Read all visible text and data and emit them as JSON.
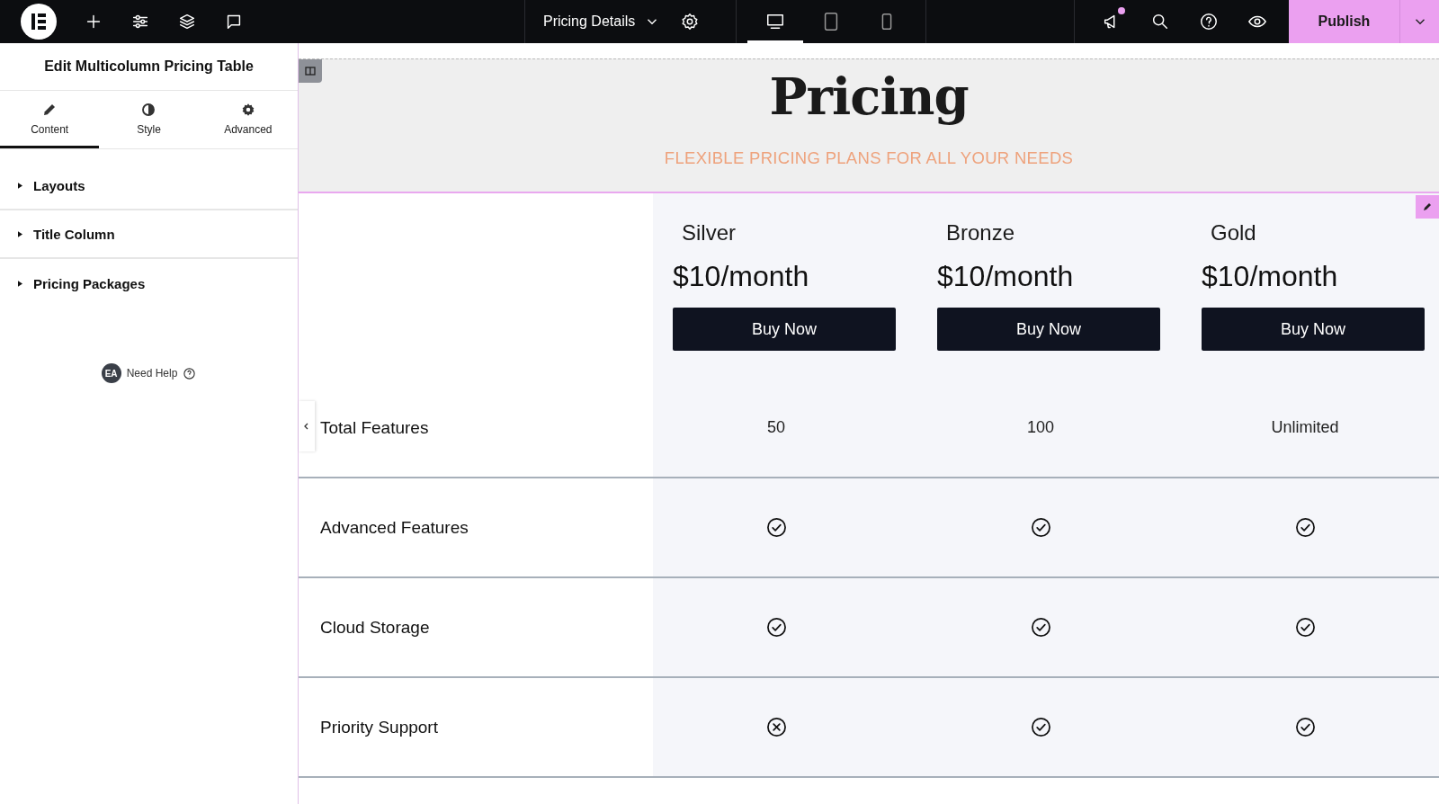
{
  "topbar": {
    "page_title": "Pricing Details",
    "devices": [
      {
        "kind": "desktop",
        "selected": true
      },
      {
        "kind": "tablet",
        "selected": false
      },
      {
        "kind": "mobile",
        "selected": false
      }
    ],
    "notification": true,
    "publish_label": "Publish"
  },
  "panel": {
    "title": "Edit Multicolumn Pricing Table",
    "tabs": [
      {
        "label": "Content",
        "kind": "pencil",
        "selected": true
      },
      {
        "label": "Style",
        "kind": "contrast",
        "selected": false
      },
      {
        "label": "Advanced",
        "kind": "gear",
        "selected": false
      }
    ],
    "sections": [
      {
        "label": "Layouts",
        "expanded": false
      },
      {
        "label": "Title Column",
        "expanded": false
      },
      {
        "label": "Pricing Packages",
        "expanded": false
      }
    ],
    "help": {
      "badge": "EA",
      "label": "Need Help"
    }
  },
  "page": {
    "heading": "Pricing",
    "subheading": "FLEXIBLE PRICING PLANS FOR ALL YOUR NEEDS",
    "plans": [
      {
        "name": "Silver",
        "price": "$10/month",
        "button": "Buy Now"
      },
      {
        "name": "Bronze",
        "price": "$10/month",
        "button": "Buy Now"
      },
      {
        "name": "Gold",
        "price": "$10/month",
        "button": "Buy Now"
      }
    ],
    "rows": [
      {
        "label": "Total Features",
        "cells": [
          {
            "kind": "text",
            "text": "50"
          },
          {
            "kind": "text",
            "text": "100"
          },
          {
            "kind": "text",
            "text": "Unlimited"
          }
        ]
      },
      {
        "label": "Advanced Features",
        "cells": [
          {
            "kind": "check"
          },
          {
            "kind": "check"
          },
          {
            "kind": "check"
          }
        ]
      },
      {
        "label": "Cloud Storage",
        "cells": [
          {
            "kind": "check"
          },
          {
            "kind": "check"
          },
          {
            "kind": "check"
          }
        ]
      },
      {
        "label": "Priority Support",
        "cells": [
          {
            "kind": "cross"
          },
          {
            "kind": "check"
          },
          {
            "kind": "check"
          }
        ]
      }
    ]
  }
}
